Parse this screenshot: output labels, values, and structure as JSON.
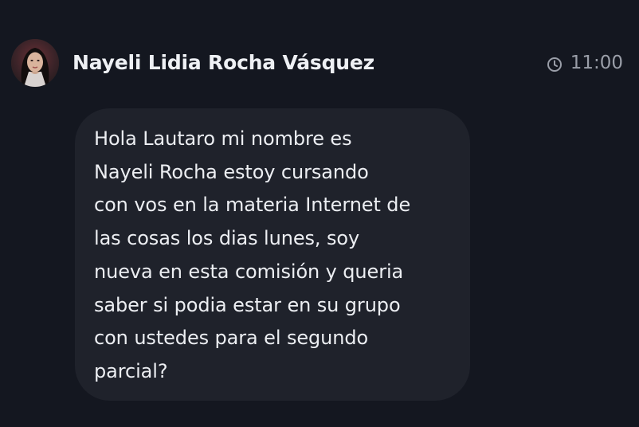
{
  "message": {
    "sender": "Nayeli Lidia Rocha Vásquez",
    "time": "11:00",
    "text": "Hola Lautaro mi nombre es\nNayeli Rocha estoy cursando\ncon vos en la materia Internet de\nlas cosas los dias lunes, soy\nnueva en esta comisión y queria\nsaber si podia estar en su grupo\ncon ustedes para el segundo\nparcial?",
    "icons": {
      "avatar": "user-avatar-photo",
      "time": "clock-icon"
    }
  },
  "colors": {
    "background": "#141720",
    "bubble": "#1f222b",
    "text": "#eceef2",
    "muted": "#9a9ea8"
  }
}
